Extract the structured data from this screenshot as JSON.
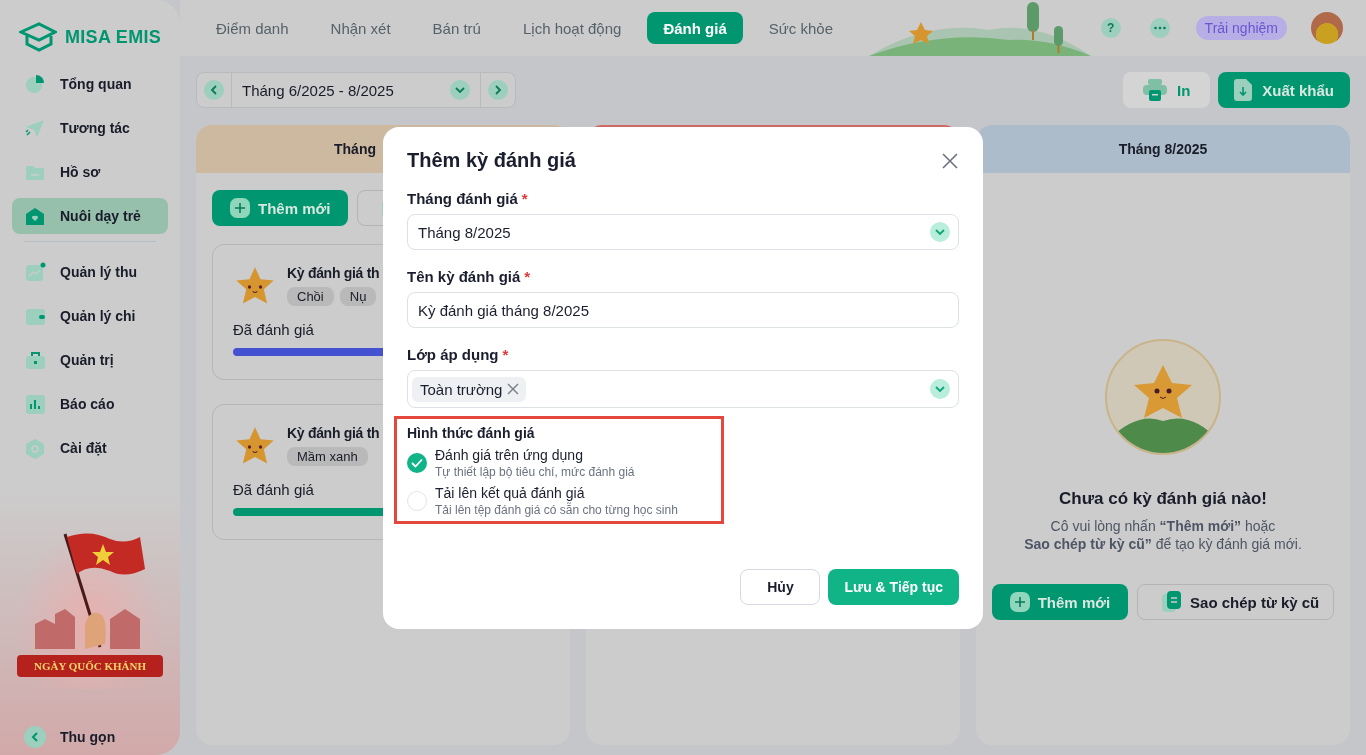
{
  "sidebar": {
    "logo": "MISA EMIS",
    "sections": [
      {
        "items": [
          {
            "label": "Tổng quan",
            "selected": false
          },
          {
            "label": "Tương tác",
            "selected": false
          },
          {
            "label": "Hồ sơ",
            "selected": false
          },
          {
            "label": "Nuôi dạy trẻ",
            "selected": true
          }
        ]
      },
      {
        "items": [
          {
            "label": "Quản lý thu",
            "selected": false
          },
          {
            "label": "Quản lý chi",
            "selected": false
          },
          {
            "label": "Quản trị",
            "selected": false
          },
          {
            "label": "Báo cáo",
            "selected": false
          },
          {
            "label": "Cài đặt",
            "selected": false
          }
        ]
      }
    ],
    "banner_text": "NGÀY QUỐC KHÁNH",
    "collapse": "Thu gọn"
  },
  "tabs": [
    {
      "label": "Điểm danh",
      "selected": false
    },
    {
      "label": "Nhận xét",
      "selected": false
    },
    {
      "label": "Bán trú",
      "selected": false
    },
    {
      "label": "Lịch hoạt động",
      "selected": false
    },
    {
      "label": "Đánh giá",
      "selected": true
    },
    {
      "label": "Sức khỏe",
      "selected": false
    }
  ],
  "topbar": {
    "help": "?",
    "trial": "Trải nghiệm"
  },
  "toolbar": {
    "period": "Tháng 6/2025 - 8/2025",
    "print": "In",
    "export": "Xuất khẩu"
  },
  "columns": [
    {
      "kind": "list",
      "header": "Tháng",
      "color": "#cdb99f",
      "add_button": "Thêm mới",
      "cards": [
        {
          "title": "Kỳ đánh giá th",
          "tags": [
            "Chồi",
            "Nụ"
          ],
          "progress_label": "Đã đánh giá",
          "color": "#4451d0"
        },
        {
          "title": "Kỳ đánh giá th",
          "tags": [
            "Mầm xanh"
          ],
          "progress_label": "Đã đánh giá",
          "color": "#009670"
        }
      ]
    },
    {
      "kind": "hidden",
      "color": "#d06868"
    },
    {
      "kind": "empty",
      "header": "Tháng 8/2025",
      "color": "#adbccb",
      "title": "Chưa có kỳ đánh giá nào!",
      "lines": [
        "Cô vui lòng nhấn **“Thêm mới”** hoặc",
        "**Sao chép từ kỳ cũ”** để tạo kỳ đánh giá mới."
      ],
      "add_button": "Thêm mới",
      "copy_button": "Sao chép từ kỳ cũ"
    }
  ],
  "modal": {
    "title": "Thêm kỳ đánh giá",
    "required_mark": "*",
    "fields": [
      {
        "kind": "select",
        "label": "Tháng đánh giá",
        "required": true,
        "value": "Tháng 8/2025"
      },
      {
        "kind": "text",
        "label": "Tên kỳ đánh giá",
        "required": true,
        "value": "Kỳ đánh giá tháng 8/2025"
      },
      {
        "kind": "tags",
        "label": "Lớp áp dụng",
        "required": true,
        "tags": [
          "Toàn trường"
        ]
      }
    ],
    "method": {
      "label": "Hình thức đánh giá",
      "options": [
        {
          "title": "Đánh giá trên ứng dụng",
          "description": "Tự thiết lập bộ tiêu chí, mức đánh giá",
          "selected": true
        },
        {
          "title": "Tải lên kết quả đánh giá",
          "description": "Tải lên tệp đánh giá có sẵn cho từng học sinh",
          "selected": false
        }
      ]
    },
    "cancel": "Hủy",
    "submit": "Lưu & Tiếp tục"
  }
}
